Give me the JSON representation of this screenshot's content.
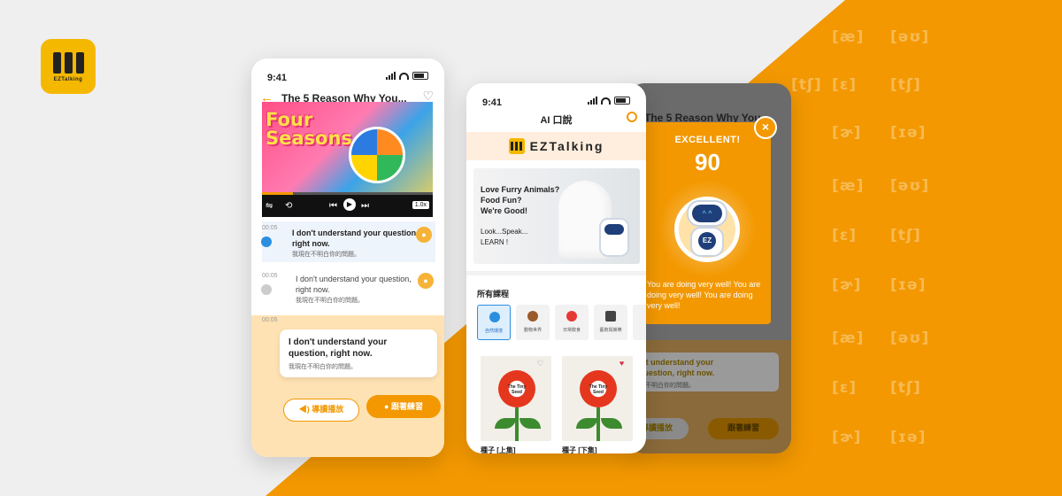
{
  "brand": {
    "name": "EZTalking"
  },
  "phonetics": [
    [
      "[æ]",
      "[əʊ]"
    ],
    [
      "[tʃ]",
      "[ɛ]",
      "[tʃ]"
    ],
    [
      "[ɚ]",
      "[ɪə]"
    ],
    [
      "[æ]",
      "[əʊ]"
    ],
    [
      "[ɛ]",
      "[tʃ]"
    ],
    [
      "[ɚ]",
      "[ɪə]"
    ],
    [
      "[æ]",
      "[əʊ]"
    ],
    [
      "[ɛ]",
      "[tʃ]"
    ],
    [
      "[ɚ]",
      "[ɪə]"
    ]
  ],
  "phone1": {
    "time": "9:41",
    "title": "The 5 Reason Why You...",
    "video": {
      "title_line1": "Four",
      "title_line2": "Seasons",
      "speed": "1.0x",
      "progress": 0.18
    },
    "lines": [
      {
        "time": "00:05",
        "en_line1": "I don't understand your question,",
        "en_line2": "right now.",
        "zh": "我現在不明白你的問題。"
      },
      {
        "time": "00:05",
        "en_line1": "I don't understand your question,",
        "en_line2": "right now.",
        "zh": "我現在不明白你的問題。"
      },
      {
        "time": "00:05",
        "en_line1": "I don't understand your",
        "en_line2": "question, right now.",
        "zh": "我現在不明白你的問題。"
      }
    ],
    "guide_button": "導讀播放",
    "practice_button": "跟著練習"
  },
  "phone2": {
    "time": "9:41",
    "title": "AI 口說",
    "banner": {
      "line1": "Love Furry Animals?",
      "line2": "Food Fun?",
      "line3": "We're Good!",
      "line4": "Look...Speak...",
      "line5": "LEARN !"
    },
    "section_title": "所有課程",
    "categories": [
      {
        "label": "自然環境",
        "color": "#2b8fe0"
      },
      {
        "label": "動物世界",
        "color": "#9a5a2a"
      },
      {
        "label": "日常飲食",
        "color": "#e53935"
      },
      {
        "label": "藝術與娛樂",
        "color": "#444444"
      }
    ],
    "books": [
      {
        "title": "種子 [上集]",
        "cover_title": "The Tiny Seed",
        "favorited": false
      },
      {
        "title": "種子 [下集]",
        "cover_title": "The Tiny Seed",
        "favorited": true
      }
    ]
  },
  "phone3": {
    "title": "The 5 Reason Why You...",
    "line_line1": "n't understand your",
    "line_line2": "question, right now.",
    "zh": "在不明白你的問題。",
    "guide_button": "導讀播放",
    "practice_button": "跟著練習"
  },
  "popup": {
    "heading": "EXCELLENT!",
    "score": "90",
    "robot_badge": "EZ",
    "message": "You are doing very well! You are doing very well! You are doing very well!"
  },
  "colors": {
    "accent": "#f39800",
    "logo": "#f5b800"
  }
}
